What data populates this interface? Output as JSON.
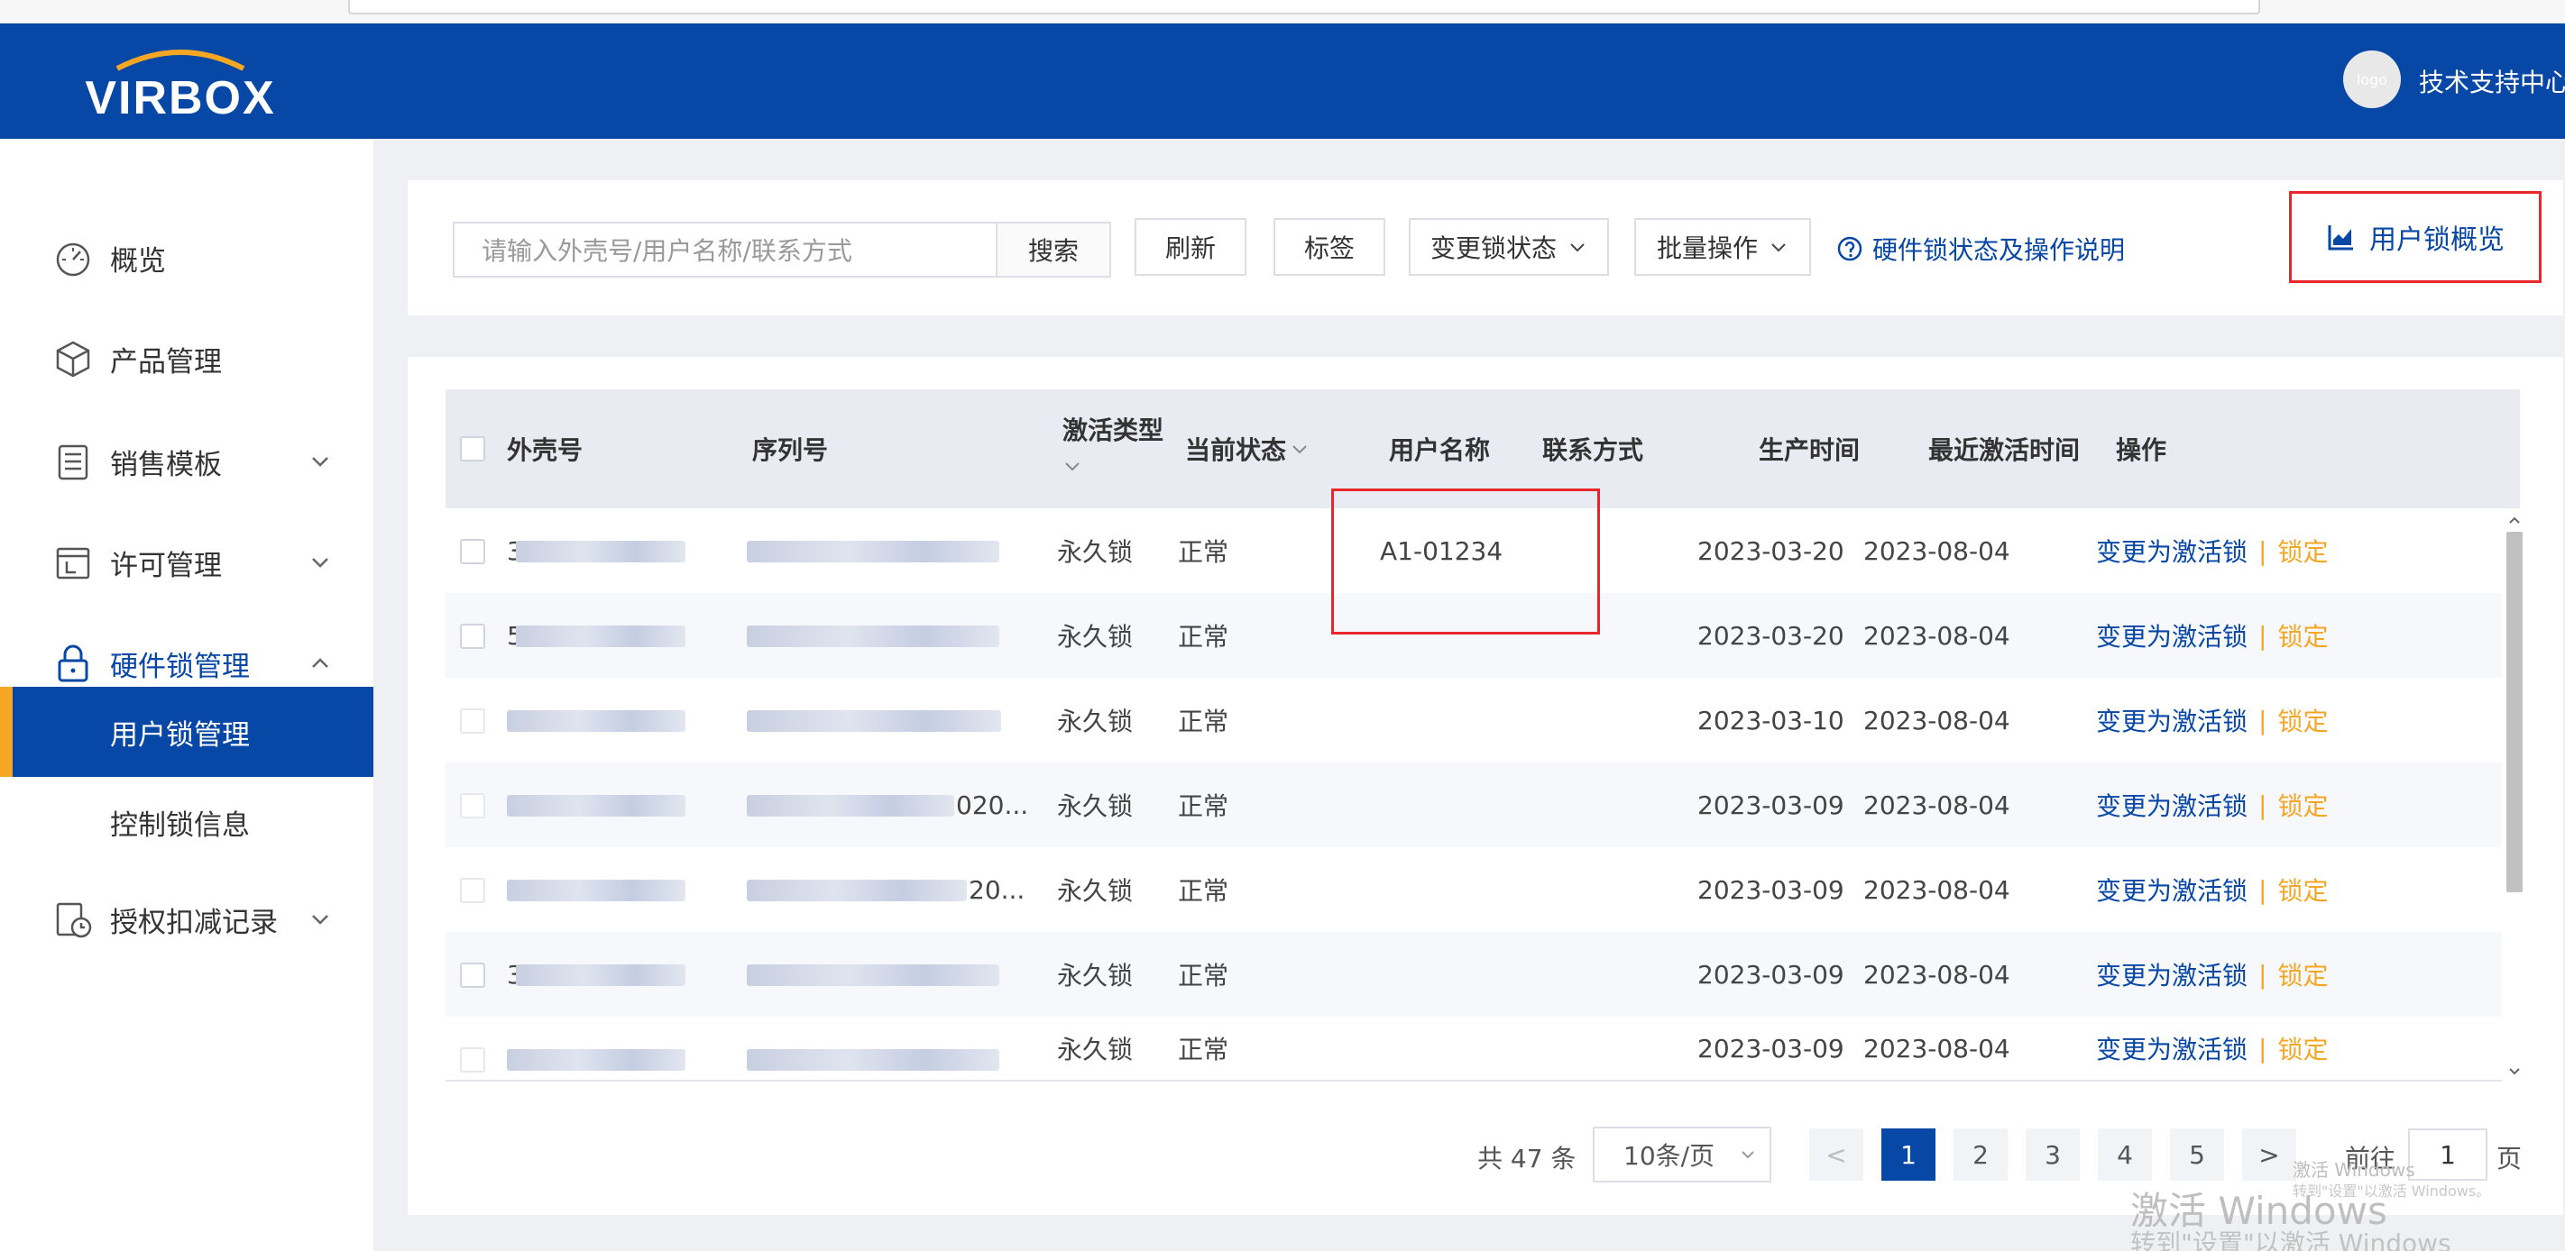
{
  "header": {
    "logo_text": "VIRBOX",
    "avatar_text": "logo",
    "user_name": "技术支持中心"
  },
  "sidebar": {
    "items": [
      {
        "label": "概览",
        "icon": "dashboard-icon"
      },
      {
        "label": "产品管理",
        "icon": "cube-icon"
      },
      {
        "label": "销售模板",
        "icon": "template-icon"
      },
      {
        "label": "许可管理",
        "icon": "license-icon"
      },
      {
        "label": "硬件锁管理",
        "icon": "lock-icon"
      },
      {
        "label": "授权扣减记录",
        "icon": "history-icon"
      }
    ],
    "sub_items": [
      {
        "label": "用户锁管理"
      },
      {
        "label": "控制锁信息"
      }
    ]
  },
  "toolbar": {
    "search_placeholder": "请输入外壳号/用户名称/联系方式",
    "search_label": "搜索",
    "refresh_label": "刷新",
    "tag_label": "标签",
    "change_status_label": "变更锁状态",
    "batch_label": "批量操作",
    "help_label": "硬件锁状态及操作说明",
    "overview_label": "用户锁概览"
  },
  "table": {
    "columns": [
      "外壳号",
      "序列号",
      "激活类型",
      "当前状态",
      "用户名称",
      "联系方式",
      "生产时间",
      "最近激活时间",
      "操作"
    ],
    "rows": [
      {
        "shell_partial": "3",
        "serial_partial": "",
        "type": "永久锁",
        "status": "正常",
        "user": "A1-01234",
        "contact": "",
        "produced": "2023-03-20",
        "activated": "2023-08-04",
        "action": "变更为激活锁",
        "sep": "|",
        "lock": "锁定"
      },
      {
        "shell_partial": "5",
        "serial_partial": "",
        "type": "永久锁",
        "status": "正常",
        "user": "",
        "contact": "",
        "produced": "2023-03-20",
        "activated": "2023-08-04",
        "action": "变更为激活锁",
        "sep": "|",
        "lock": "锁定"
      },
      {
        "shell_partial": "",
        "serial_partial": "",
        "type": "永久锁",
        "status": "正常",
        "user": "",
        "contact": "",
        "produced": "2023-03-10",
        "activated": "2023-08-04",
        "action": "变更为激活锁",
        "sep": "|",
        "lock": "锁定"
      },
      {
        "shell_partial": "",
        "serial_partial": "020...",
        "type": "永久锁",
        "status": "正常",
        "user": "",
        "contact": "",
        "produced": "2023-03-09",
        "activated": "2023-08-04",
        "action": "变更为激活锁",
        "sep": "|",
        "lock": "锁定"
      },
      {
        "shell_partial": "",
        "serial_partial": "20...",
        "type": "永久锁",
        "status": "正常",
        "user": "",
        "contact": "",
        "produced": "2023-03-09",
        "activated": "2023-08-04",
        "action": "变更为激活锁",
        "sep": "|",
        "lock": "锁定"
      },
      {
        "shell_partial": "3",
        "serial_partial": "",
        "type": "永久锁",
        "status": "正常",
        "user": "",
        "contact": "",
        "produced": "2023-03-09",
        "activated": "2023-08-04",
        "action": "变更为激活锁",
        "sep": "|",
        "lock": "锁定"
      },
      {
        "shell_partial": "",
        "serial_partial": "",
        "type": "永久锁",
        "status": "正常",
        "user": "",
        "contact": "",
        "produced": "2023-03-09",
        "activated": "2023-08-04",
        "action": "变更为激活锁",
        "sep": "|",
        "lock": "锁定"
      }
    ]
  },
  "pagination": {
    "total": "共 47 条",
    "page_size": "10条/页",
    "prev": "<",
    "pages": [
      "1",
      "2",
      "3",
      "4",
      "5"
    ],
    "next": ">",
    "goto_label": "前往",
    "goto_value": "1",
    "goto_unit": "页"
  },
  "watermark": {
    "small_line1": "激活 Windows",
    "small_line2": "转到\"设置\"以激活 Windows。",
    "big_line1": "激活 Windows",
    "big_line2": "转到\"设置\"以激活 Windows"
  },
  "colors": {
    "brand": "#0747a6",
    "accent": "#f5a623",
    "highlight": "#e8262b"
  }
}
